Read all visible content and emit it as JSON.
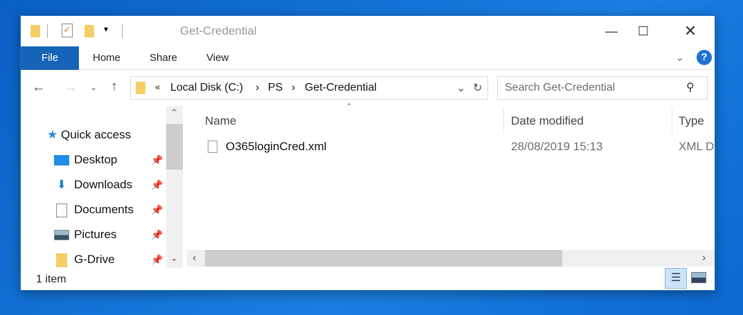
{
  "window": {
    "title": "Get-Credential"
  },
  "ribbon": {
    "tabs": [
      "File",
      "Home",
      "Share",
      "View"
    ],
    "help": "?"
  },
  "address": {
    "path": [
      "Local Disk (C:)",
      "PS",
      "Get-Credential"
    ],
    "overflow": "«"
  },
  "search": {
    "placeholder": "Search Get-Credential"
  },
  "nav": {
    "quick_access": "Quick access",
    "items": [
      "Desktop",
      "Downloads",
      "Documents",
      "Pictures",
      "G-Drive"
    ]
  },
  "columns": {
    "name": "Name",
    "date": "Date modified",
    "type": "Type"
  },
  "files": [
    {
      "name": "O365loginCred.xml",
      "date": "28/08/2019 15:13",
      "type": "XML D"
    }
  ],
  "status": {
    "count": "1 item"
  }
}
